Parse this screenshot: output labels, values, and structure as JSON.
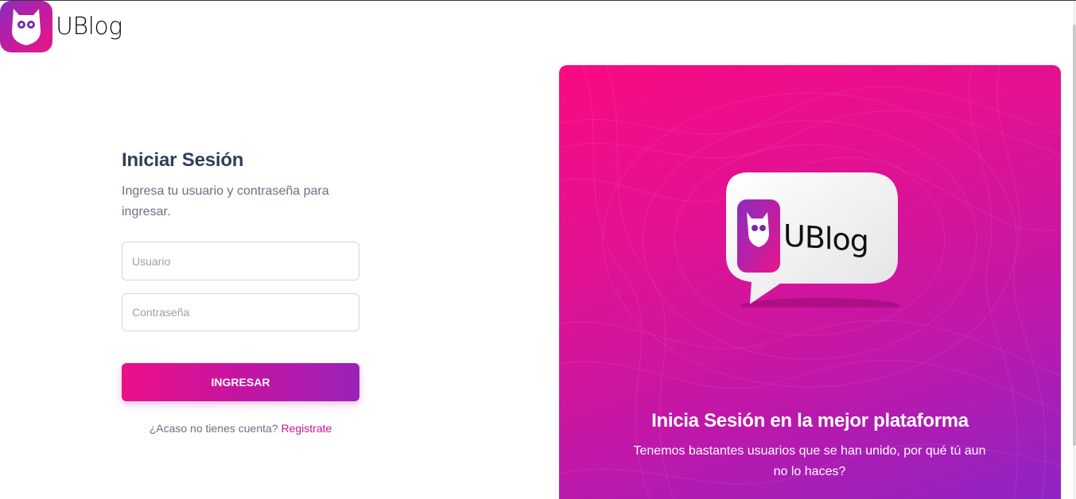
{
  "header": {
    "brand": "UBlog"
  },
  "login": {
    "title": "Iniciar Sesión",
    "subtitle": "Ingresa tu usuario y contraseña para ingresar.",
    "username_placeholder": "Usuario",
    "password_placeholder": "Contraseña",
    "submit_label": "INGRESAR",
    "register_prompt": "¿Acaso no tienes cuenta?",
    "register_link": "Registrate"
  },
  "promo": {
    "logo_brand": "UBlog",
    "title": "Inicia Sesión en la mejor plataforma",
    "text": "Tenemos bastantes usuarios que se han unido, por qué tú aun no lo haces?"
  },
  "colors": {
    "accent": "#e8168a",
    "accent_secondary": "#8b25c6",
    "title": "#2f3e5c"
  },
  "icons": [
    "owl-logo-icon",
    "bubble-logo-icon"
  ]
}
